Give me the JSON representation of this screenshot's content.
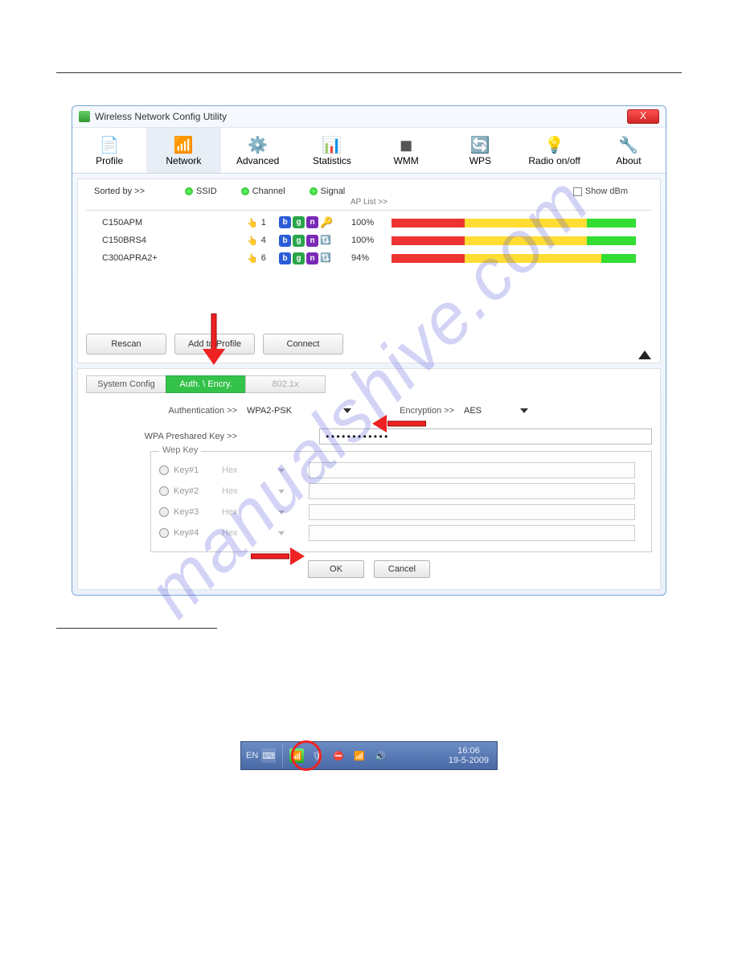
{
  "window": {
    "title": "Wireless Network Config Utility",
    "toolbar": [
      "Profile",
      "Network",
      "Advanced",
      "Statistics",
      "WMM",
      "WPS",
      "Radio on/off",
      "About"
    ],
    "selected_tool": "Network"
  },
  "sortrow": {
    "label": "Sorted by >>",
    "items": [
      "SSID",
      "Channel",
      "Signal"
    ],
    "aplist_label": "AP List >>",
    "showdbm": "Show dBm"
  },
  "aplist": [
    {
      "ssid": "C150APM",
      "channel": "1",
      "badges": [
        "b",
        "g",
        "n"
      ],
      "extra": "key",
      "signal": "100%",
      "bars": [
        30,
        50,
        20
      ]
    },
    {
      "ssid": "C150BRS4",
      "channel": "4",
      "badges": [
        "b",
        "g",
        "n"
      ],
      "extra": "arrows",
      "signal": "100%",
      "bars": [
        30,
        50,
        20
      ]
    },
    {
      "ssid": "C300APRA2+",
      "channel": "6",
      "badges": [
        "b",
        "g",
        "n"
      ],
      "extra": "arrows",
      "signal": "94%",
      "bars": [
        30,
        56,
        14
      ]
    }
  ],
  "actions": {
    "rescan": "Rescan",
    "addprofile": "Add to Profile",
    "connect": "Connect"
  },
  "tabs": {
    "systemconfig": "System Config",
    "authencry": "Auth. \\ Encry.",
    "dot1x": "802.1x"
  },
  "form": {
    "auth_label": "Authentication >>",
    "auth_value": "WPA2-PSK",
    "enc_label": "Encryption >>",
    "enc_value": "AES",
    "psk_label": "WPA Preshared Key >>",
    "psk_value": "••••••••••••",
    "wep_title": "Wep Key",
    "wep": [
      {
        "name": "Key#1",
        "fmt": "Hex"
      },
      {
        "name": "Key#2",
        "fmt": "Hex"
      },
      {
        "name": "Key#3",
        "fmt": "Hex"
      },
      {
        "name": "Key#4",
        "fmt": "Hex"
      }
    ],
    "ok": "OK",
    "cancel": "Cancel"
  },
  "taskbar": {
    "lang": "EN",
    "time_top": "16:06",
    "time_bottom": "19-5-2009"
  }
}
